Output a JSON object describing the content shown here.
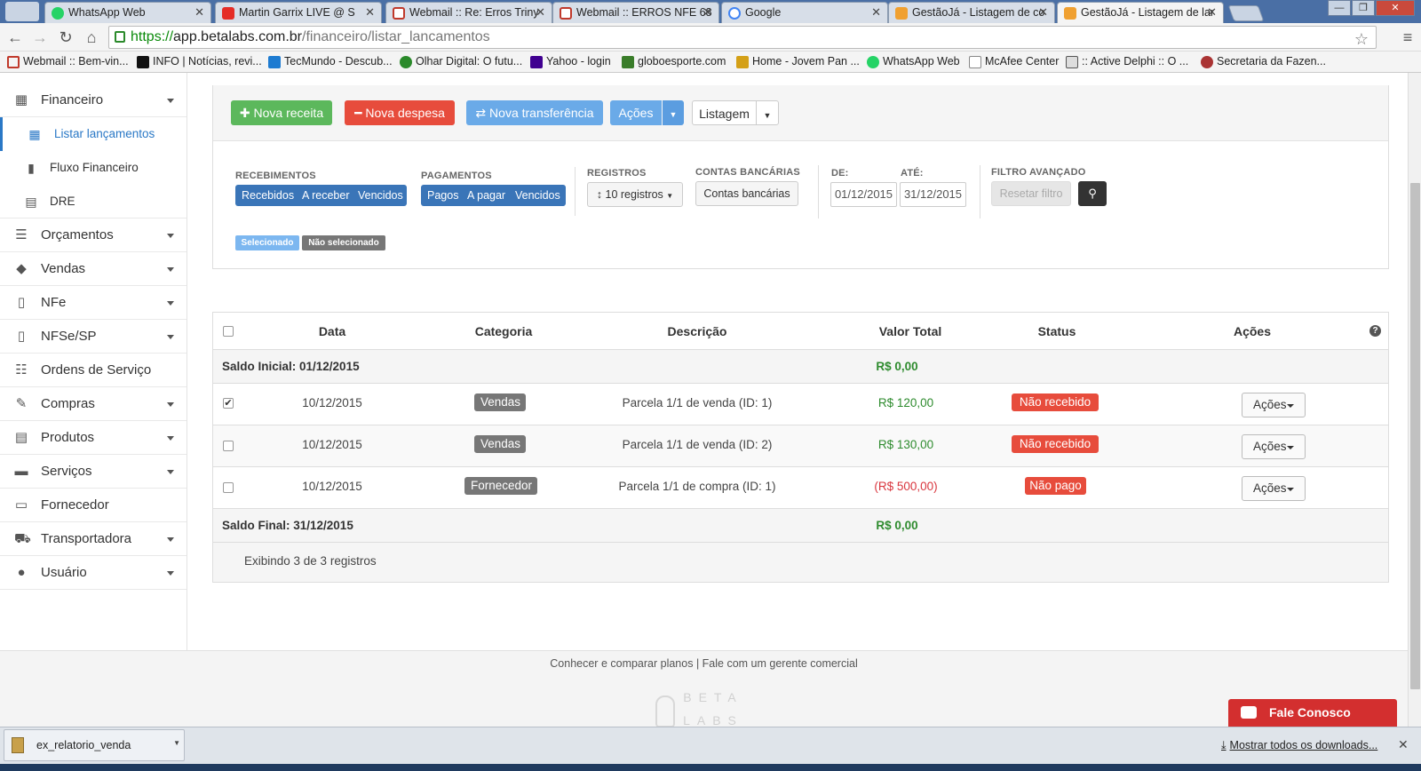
{
  "browser": {
    "tabs": [
      {
        "label": "WhatsApp Web",
        "icon": "whatsapp-icon",
        "color": "#25d366"
      },
      {
        "label": "Martin Garrix LIVE @ S",
        "icon": "youtube-icon",
        "color": "#e52d27"
      },
      {
        "label": "Webmail :: Re: Erros Triny",
        "icon": "webmail-icon",
        "color": "#c0392b"
      },
      {
        "label": "Webmail :: ERROS NFE 68",
        "icon": "webmail-icon",
        "color": "#c0392b"
      },
      {
        "label": "Google",
        "icon": "google-icon",
        "color": "#4285f4"
      },
      {
        "label": "GestãoJá - Listagem de co",
        "icon": "gestaoja-icon",
        "color": "#f0a030"
      },
      {
        "label": "GestãoJá - Listagem de lar",
        "icon": "gestaoja-icon",
        "color": "#f0a030"
      }
    ],
    "url_scheme": "https://",
    "url_host": "app.betalabs.com.br",
    "url_path": "/financeiro/listar_lancamentos",
    "bookmarks": [
      "Webmail :: Bem-vin...",
      "INFO | Notícias, revi...",
      "TecMundo - Descub...",
      "Olhar Digital: O futu...",
      "Yahoo - login",
      "globoesporte.com",
      "Home - Jovem Pan ...",
      "WhatsApp Web",
      "McAfee Center",
      ":: Active Delphi :: O ...",
      "Secretaria da Fazen..."
    ]
  },
  "sidebar": {
    "financeiro": "Financeiro",
    "sub": [
      "Listar lançamentos",
      "Fluxo Financeiro",
      "DRE"
    ],
    "items": [
      "Orçamentos",
      "Vendas",
      "NFe",
      "NFSe/SP",
      "Ordens de Serviço",
      "Compras",
      "Produtos",
      "Serviços",
      "Fornecedor",
      "Transportadora",
      "Usuário"
    ]
  },
  "actions": {
    "nova_receita": "Nova receita",
    "nova_despesa": "Nova despesa",
    "nova_transferencia": "Nova transferência",
    "acoes": "Ações",
    "listagem": "Listagem"
  },
  "filters": {
    "recebimentos_label": "RECEBIMENTOS",
    "recebimentos": [
      "Recebidos",
      "A receber",
      "Vencidos"
    ],
    "pagamentos_label": "PAGAMENTOS",
    "pagamentos": [
      "Pagos",
      "A pagar",
      "Vencidos"
    ],
    "registros_label": "REGISTROS",
    "registros_value": "10 registros",
    "contas_label": "CONTAS BANCÁRIAS",
    "contas_button": "Contas bancárias",
    "de_label": "DE:",
    "de_value": "01/12/2015",
    "ate_label": "ATÉ:",
    "ate_value": "31/12/2015",
    "avancado_label": "FILTRO AVANÇADO",
    "reset_button": "Resetar filtro",
    "legend_selected": "Selecionado",
    "legend_unselected": "Não selecionado"
  },
  "table": {
    "headers": [
      "Data",
      "Categoria",
      "Descrição",
      "Valor Total",
      "Status",
      "Ações"
    ],
    "saldo_inicial_label": "Saldo Inicial: 01/12/2015",
    "saldo_inicial_value": "R$ 0,00",
    "rows": [
      {
        "checked": true,
        "date": "10/12/2015",
        "category": "Vendas",
        "description": "Parcela 1/1 de venda (ID: 1)",
        "value": "R$ 120,00",
        "status": "Não recebido",
        "action": "Ações"
      },
      {
        "checked": false,
        "date": "10/12/2015",
        "category": "Vendas",
        "description": "Parcela 1/1 de venda (ID: 2)",
        "value": "R$ 130,00",
        "status": "Não recebido",
        "action": "Ações"
      },
      {
        "checked": false,
        "date": "10/12/2015",
        "category": "Fornecedor",
        "description": "Parcela 1/1 de compra (ID: 1)",
        "value": "(R$ 500,00)",
        "status": "Não pago",
        "action": "Ações"
      }
    ],
    "saldo_final_label": "Saldo Final: 31/12/2015",
    "saldo_final_value": "R$ 0,00",
    "footer_text": "Exibindo 3 de 3 registros"
  },
  "footer": {
    "links": "Conhecer e comparar planos | Fale com um gerente comercial",
    "logo_text": "BETA LABS"
  },
  "chat": {
    "label": "Fale Conosco"
  },
  "downloads": {
    "file": "ex_relatorio_venda",
    "show_all": "Mostrar todos os downloads..."
  }
}
